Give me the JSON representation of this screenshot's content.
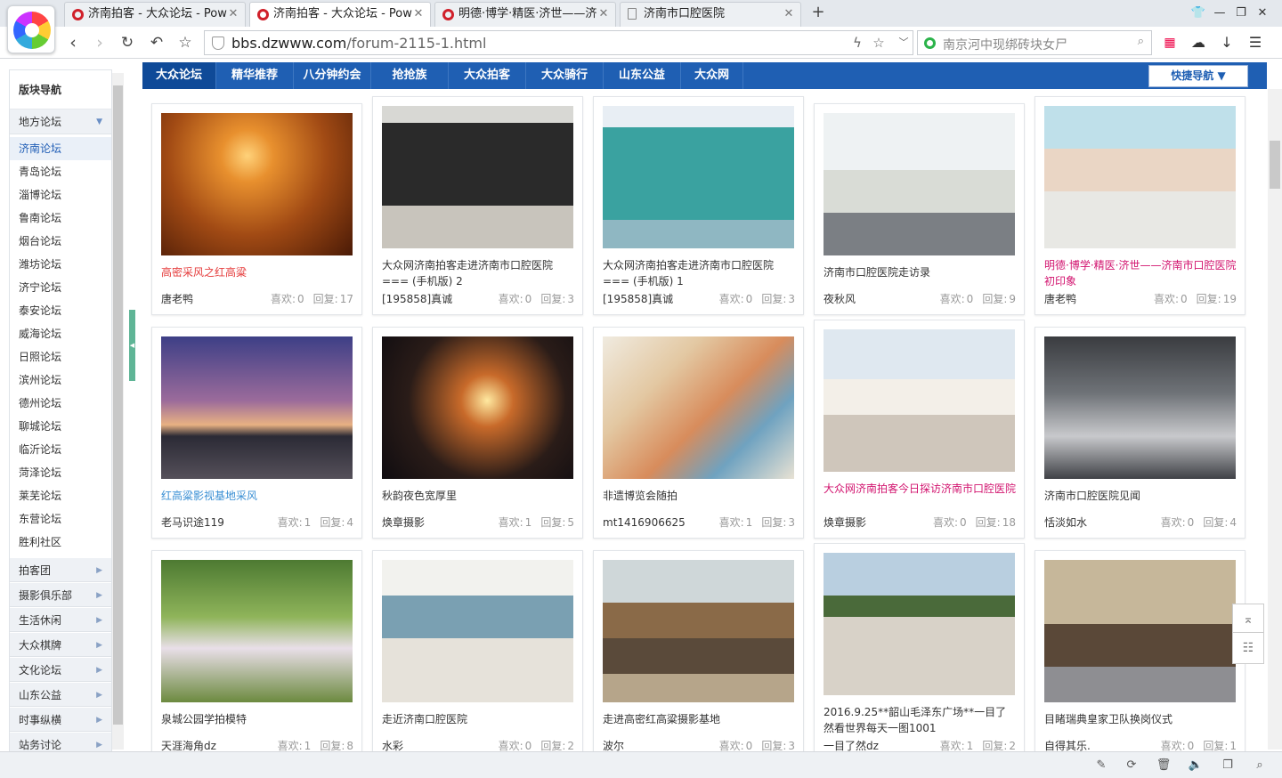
{
  "browser": {
    "tabs": [
      {
        "title": "济南拍客 - 大众论坛 - Pow",
        "active": false
      },
      {
        "title": "济南拍客 - 大众论坛 - Pow",
        "active": true
      },
      {
        "title": "明德·博学·精医·济世——济南",
        "active": false
      },
      {
        "title": "济南市口腔医院",
        "active": false
      }
    ],
    "new_tab": "+",
    "url_domain": "bbs.dzwww.com",
    "url_path": "/forum-2115-1.html",
    "search_text": "南京河中现绑砖块女尸"
  },
  "sidebar": {
    "header": "版块导航",
    "group": "地方论坛",
    "items": [
      "济南论坛",
      "青岛论坛",
      "淄博论坛",
      "鲁南论坛",
      "烟台论坛",
      "潍坊论坛",
      "济宁论坛",
      "泰安论坛",
      "威海论坛",
      "日照论坛",
      "滨州论坛",
      "德州论坛",
      "聊城论坛",
      "临沂论坛",
      "菏泽论坛",
      "莱芜论坛",
      "东营论坛",
      "胜利社区"
    ],
    "selected_index": 0,
    "sections": [
      "拍客团",
      "摄影俱乐部",
      "生活休闲",
      "大众棋牌",
      "文化论坛",
      "山东公益",
      "时事纵横",
      "站务讨论"
    ]
  },
  "nav": {
    "items": [
      "大众论坛",
      "精华推荐",
      "八分钟约会",
      "抢抢族",
      "大众拍客",
      "大众骑行",
      "山东公益",
      "大众网"
    ],
    "active_index": 0,
    "quick_nav": "快捷导航 ▼"
  },
  "labels": {
    "like": "喜欢:",
    "reply": "回复:"
  },
  "posts": [
    {
      "title": "高密采风之红高粱",
      "author": "唐老鸭",
      "likes": "0",
      "replies": "17",
      "style": "hl",
      "thumb": "sunset"
    },
    {
      "title": "大众网济南拍客走进济南市口腔医院=== (手机版) 2",
      "author": "[195858]真诚",
      "likes": "0",
      "replies": "3",
      "style": "",
      "thumb": "presentation"
    },
    {
      "title": "大众网济南拍客走进济南市口腔医院=== (手机版) 1",
      "author": "[195858]真诚",
      "likes": "0",
      "replies": "3",
      "style": "",
      "thumb": "building"
    },
    {
      "title": "济南市口腔医院走访录",
      "author": "夜秋风",
      "likes": "0",
      "replies": "9",
      "style": "",
      "thumb": "hall"
    },
    {
      "title": "明德·博学·精医·济世——济南市口腔医院初印象",
      "author": "唐老鸭",
      "likes": "0",
      "replies": "19",
      "style": "pink",
      "thumb": "man"
    },
    {
      "title": "红高粱影视基地采风",
      "author": "老马识途119",
      "likes": "1",
      "replies": "4",
      "style": "blue",
      "thumb": "gate"
    },
    {
      "title": "秋韵夜色宽厚里",
      "author": "焕章摄影",
      "likes": "1",
      "replies": "5",
      "style": "",
      "thumb": "night"
    },
    {
      "title": "非遗博览会随拍",
      "author": "mt1416906625",
      "likes": "1",
      "replies": "3",
      "style": "",
      "thumb": "painting"
    },
    {
      "title": "大众网济南拍客今日探访济南市口腔医院",
      "author": "焕章摄影",
      "likes": "0",
      "replies": "18",
      "style": "pink",
      "thumb": "meeting"
    },
    {
      "title": "济南市口腔医院见闻",
      "author": "恬淡如水",
      "likes": "0",
      "replies": "4",
      "style": "",
      "thumb": "floor"
    },
    {
      "title": "泉城公园学拍模特",
      "author": "天涯海角dz",
      "likes": "1",
      "replies": "8",
      "style": "",
      "thumb": "model"
    },
    {
      "title": "走近济南口腔医院",
      "author": "水彩",
      "likes": "0",
      "replies": "2",
      "style": "",
      "thumb": "office"
    },
    {
      "title": "走进高密红高粱摄影基地",
      "author": "波尔",
      "likes": "0",
      "replies": "3",
      "style": "",
      "thumb": "hut"
    },
    {
      "title": "2016.9.25**韶山毛泽东广场**一目了然看世界每天一图1001",
      "author": "一目了然dz",
      "likes": "1",
      "replies": "2",
      "style": "",
      "thumb": "square"
    },
    {
      "title": "目睹瑞典皇家卫队换岗仪式",
      "author": "自得其乐.",
      "likes": "0",
      "replies": "1",
      "style": "",
      "thumb": "guards"
    }
  ]
}
